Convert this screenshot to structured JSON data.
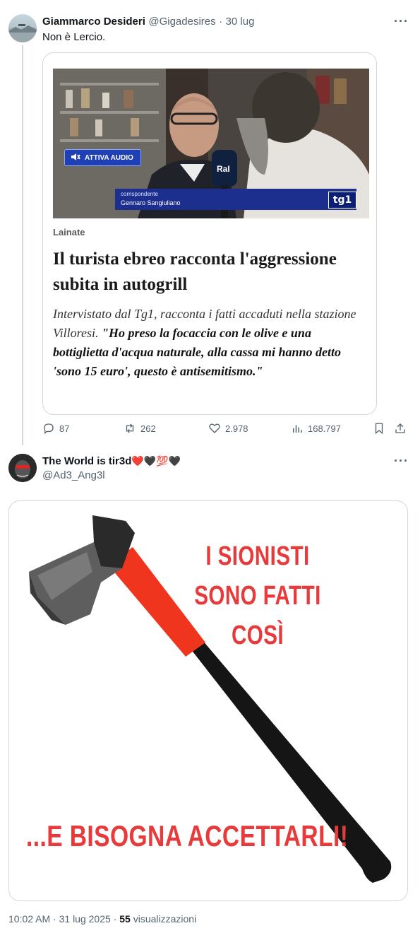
{
  "tweet1": {
    "display_name": "Giammarco Desideri",
    "handle": "@Gigadesires",
    "separator": "·",
    "date": "30 lug",
    "text": "Non è Lercio.",
    "more_icon": "more-dots-icon",
    "card": {
      "video": {
        "audio_label": "ATTIVA AUDIO",
        "mute_icon": "speaker-muted-icon",
        "role": "corrispondente",
        "name": "Gennaro Sangiuliano",
        "channel_logo": "tg1",
        "mic_logo": "RaI"
      },
      "place": "Lainate",
      "headline": "Il turista ebreo racconta l'aggressione subita in autogrill",
      "lead_plain": "Intervistato dal Tg1, racconta i fatti accaduti nella stazione Villoresi.",
      "lead_quote": "\"Ho preso la focaccia con le olive e una bottiglietta d'acqua naturale, alla cassa mi hanno detto 'sono 15 euro', questo è antisemitismo.\""
    },
    "actions": {
      "replies": "87",
      "retweets": "262",
      "likes": "2.978",
      "views": "168.797"
    }
  },
  "tweet2": {
    "display_name": "The World is tir3d",
    "emoji": "❤️🖤💯🖤",
    "handle": "@Ad3_Ang3l",
    "more_icon": "more-dots-icon",
    "meme": {
      "top_line1": "I SIONISTI",
      "top_line2": "SONO FATTI COSÌ",
      "bottom": "...E BISOGNA ACCETTARLI!"
    },
    "time": "10:02 AM",
    "separator": "·",
    "date": "31 lug 2025",
    "separator2": "·",
    "views_count": "55",
    "views_label": "visualizzazioni"
  },
  "colors": {
    "text": "#0f1419",
    "muted": "#536471",
    "border": "#cfd9de",
    "meme_red": "#e83a3a",
    "tg1_blue": "#1c2f8f"
  }
}
